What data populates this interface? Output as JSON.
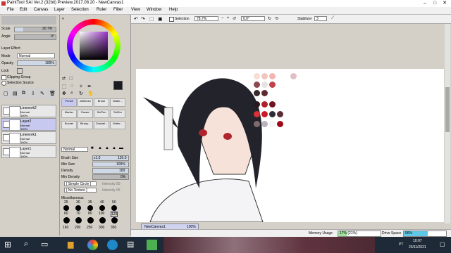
{
  "window": {
    "title": "PaintTool SAI Ver.2 (32bit) Preview.2017.08.20 - NewCanvas1",
    "minimize": "–",
    "maximize": "□",
    "close": "✕"
  },
  "menu": [
    "File",
    "Edit",
    "Canvas",
    "Layer",
    "Selection",
    "Ruler",
    "Filter",
    "View",
    "Window",
    "Help"
  ],
  "brush_props": {
    "scale_label": "Scale",
    "scale_value": "20.7%",
    "angle_label": "Angle",
    "angle_value": "0°"
  },
  "layer_effect": {
    "header": "Layer Effect",
    "mode_label": "Mode",
    "mode_value": "Normal",
    "opacity_label": "Opacity",
    "opacity_value": "100%",
    "lock_label": "Lock",
    "clipping": "Clipping Group",
    "selection_source": "Selection Source"
  },
  "layers": [
    {
      "name": "Linework2",
      "mode": "Normal",
      "opacity": "100%"
    },
    {
      "name": "Layer2",
      "mode": "Normal",
      "opacity": "100%"
    },
    {
      "name": "Linework1",
      "mode": "Normal",
      "opacity": "100%"
    },
    {
      "name": "Layer1",
      "mode": "Normal",
      "opacity": "100%"
    }
  ],
  "tools": [
    [
      "Pencil",
      "AirBrush",
      "Brush",
      "Water..."
    ],
    [
      "Marker",
      "Eraser",
      "SelPen",
      "SelErs"
    ],
    [
      "Bucket",
      "Binary...",
      "Gradati...",
      "Water..."
    ]
  ],
  "brush": {
    "blend_mode": "Normal",
    "size_label": "Brush Size",
    "size_mult": "x1.0",
    "size_value": "120.0",
    "min_size_label": "Min Size",
    "min_size_value": "100%",
    "density_label": "Density",
    "density_value": "100",
    "min_density_label": "Min Density",
    "min_density_value": "0%",
    "shape": "[ Simple Circle ]",
    "shape_intensity": "Intensity 50",
    "texture": "[ No Texture ]",
    "texture_intensity": "Intensity 95",
    "misc_label": "Miscellaneous"
  },
  "brush_sizes": {
    "row1": [
      "25",
      "30",
      "35",
      "40",
      "50"
    ],
    "row2": [
      "60",
      "70",
      "80",
      "100",
      "120"
    ],
    "row3": [
      "160",
      "200",
      "250",
      "300",
      "350"
    ]
  },
  "canvas_toolbar": {
    "selection_label": "Selection",
    "zoom": "78.7%",
    "angle": "0.0°",
    "stabilizer_label": "Stabilizer",
    "stabilizer_value": "3"
  },
  "navigator": {
    "name": "NewCanvas1",
    "zoom": "100%"
  },
  "status": {
    "memory_label": "Memory Usage",
    "memory_value": "17% (21%)",
    "memory_fraction": 0.21,
    "drive_label": "Drive Space",
    "drive_value": "56%",
    "drive_fraction": 0.56
  },
  "taskbar": {
    "time": "10:07",
    "date": "23/11/2021",
    "lang": "PT"
  },
  "colors": {
    "canvas_swatches": [
      [
        "#f7ddd3",
        "#f2c6bc",
        "#f5b4b0",
        "#e0c0c7"
      ],
      [
        "#8c4a52",
        "#e8e1e2",
        "#c0444a"
      ],
      [
        "#3a2a2f",
        "#5d2a30"
      ],
      [
        "#2a1a20",
        "#b0202a",
        "#701420"
      ],
      [
        "#d93036",
        "#c91c2b",
        "#2d2d35",
        "#5a2c34"
      ],
      [
        "#7e6a6e",
        "#b9b3bb",
        "#f5f5f7",
        "#9d0a1a"
      ]
    ],
    "current_color": "#1b1b22",
    "accent_selected": "#c7c9f0"
  }
}
